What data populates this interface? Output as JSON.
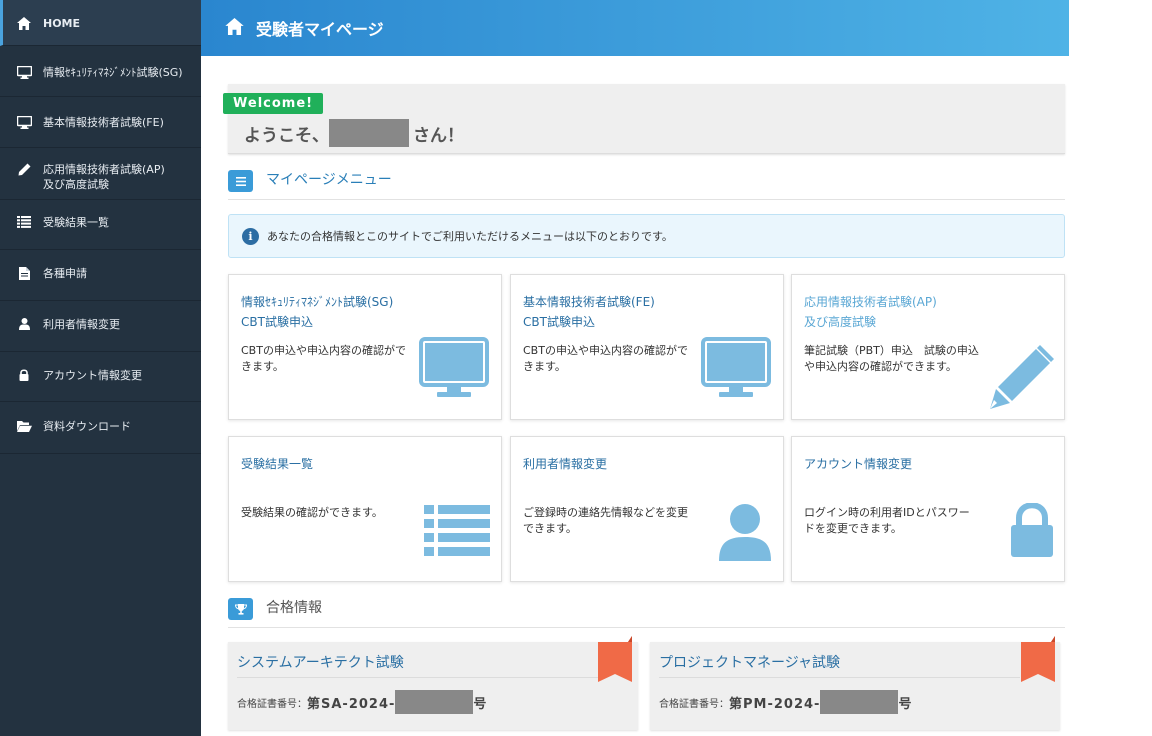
{
  "sidebar": {
    "items": [
      {
        "label": "HOME",
        "icon": "home-icon"
      },
      {
        "label": "情報ｾｷｭﾘﾃｨﾏﾈｼﾞﾒﾝﾄ試験(SG)",
        "icon": "monitor-icon"
      },
      {
        "label": "基本情報技術者試験(FE)",
        "icon": "monitor-icon"
      },
      {
        "label": "応用情報技術者試験(AP)",
        "label2": "及び高度試験",
        "icon": "pencil-icon"
      },
      {
        "label": "受験結果一覧",
        "icon": "list-icon"
      },
      {
        "label": "各種申請",
        "icon": "document-icon"
      },
      {
        "label": "利用者情報変更",
        "icon": "user-icon"
      },
      {
        "label": "アカウント情報変更",
        "icon": "lock-icon"
      },
      {
        "label": "資料ダウンロード",
        "icon": "folder-open-icon"
      }
    ]
  },
  "header": {
    "title": "受験者マイページ",
    "icon": "home-icon"
  },
  "welcome": {
    "tag": "Welcome!",
    "prefix": "ようこそ、",
    "suffix": "さん！"
  },
  "menu_section": {
    "title": "マイページメニュー",
    "icon": "menu-icon"
  },
  "info": {
    "text": "あなたの合格情報とこのサイトでご利用いただけるメニューは以下のとおりです。"
  },
  "cards": [
    {
      "title1": "情報ｾｷｭﾘﾃｨﾏﾈｼﾞﾒﾝﾄ試験(SG)",
      "title2": "CBT試験申込",
      "desc": "CBTの申込や申込内容の確認ができます。",
      "icon": "monitor-icon"
    },
    {
      "title1": "基本情報技術者試験(FE)",
      "title2": "CBT試験申込",
      "desc": "CBTの申込や申込内容の確認ができます。",
      "icon": "monitor-icon"
    },
    {
      "title1": "応用情報技術者試験(AP)",
      "title2": "及び高度試験",
      "desc": "筆記試験（PBT）申込　試験の申込や申込内容の確認ができます。",
      "icon": "pencil-icon"
    },
    {
      "title1": "受験結果一覧",
      "desc": "受験結果の確認ができます。",
      "icon": "list-icon"
    },
    {
      "title1": "利用者情報変更",
      "desc": "ご登録時の連絡先情報などを変更できます。",
      "icon": "user-icon"
    },
    {
      "title1": "アカウント情報変更",
      "desc": "ログイン時の利用者IDとパスワードを変更できます。",
      "icon": "lock-icon"
    }
  ],
  "pass_section": {
    "title": "合格情報",
    "icon": "trophy-icon"
  },
  "pass": [
    {
      "title": "システムアーキテクト試験",
      "label": "合格証書番号：",
      "prefix": "第SA-2024-",
      "suffix": "号"
    },
    {
      "title": "プロジェクトマネージャ試験",
      "label": "合格証書番号：",
      "prefix": "第PM-2024-",
      "suffix": "号"
    }
  ],
  "colors": {
    "sidebar": "#233240",
    "accent": "#3a9bd8",
    "icon": "#7cbbe0",
    "ribbon": "#f06a47",
    "welcome_tag": "#20b05a"
  }
}
